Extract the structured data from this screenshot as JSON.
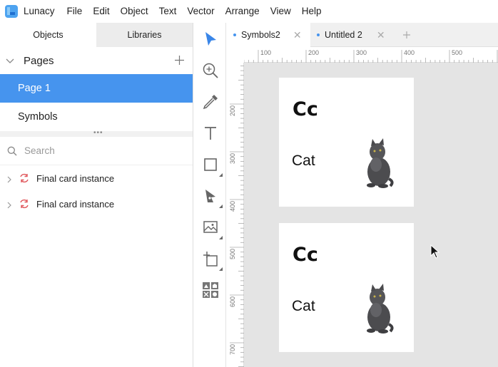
{
  "app": {
    "name": "Lunacy",
    "menu": [
      "File",
      "Edit",
      "Object",
      "Text",
      "Vector",
      "Arrange",
      "View",
      "Help"
    ]
  },
  "left_panel": {
    "tabs": [
      {
        "label": "Objects",
        "active": true
      },
      {
        "label": "Libraries",
        "active": false
      }
    ],
    "pages_title": "Pages",
    "pages": [
      {
        "label": "Page 1",
        "selected": true
      },
      {
        "label": "Symbols",
        "selected": false
      }
    ],
    "search_placeholder": "Search",
    "layers": [
      {
        "label": "Final card instance"
      },
      {
        "label": "Final card instance"
      }
    ]
  },
  "doc_tabs": [
    {
      "label": "Symbols2",
      "active": true
    },
    {
      "label": "Untitled 2",
      "active": false
    }
  ],
  "ruler": {
    "top_labels": [
      "100",
      "200",
      "300",
      "400",
      "500"
    ],
    "left_labels": [
      "200",
      "300",
      "400",
      "500",
      "600",
      "700"
    ]
  },
  "cards": [
    {
      "title": "Cc",
      "word": "Cat"
    },
    {
      "title": "Cc",
      "word": "Cat"
    }
  ],
  "colors": {
    "accent": "#4694ee",
    "canvas_bg": "#e4e4e4",
    "tool_active": "#3a86e8",
    "instance_icon": "#e0565b"
  }
}
